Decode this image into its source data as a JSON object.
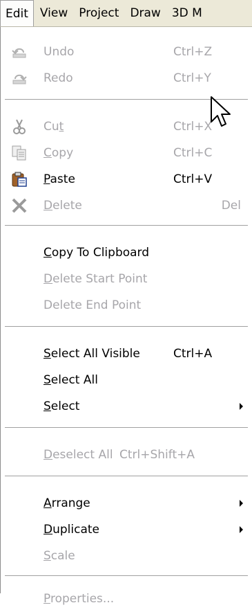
{
  "menubar": {
    "items": [
      {
        "label": "Edit"
      },
      {
        "label": "View"
      },
      {
        "label": "Project"
      },
      {
        "label": "Draw"
      },
      {
        "label": "3D M"
      }
    ]
  },
  "menu": {
    "undo": {
      "label": "Undo",
      "shortcut": "Ctrl+Z",
      "icon": "undo-icon"
    },
    "redo": {
      "label": "Redo",
      "shortcut": "Ctrl+Y",
      "icon": "redo-icon"
    },
    "cut": {
      "label_pre": "Cu",
      "label_u": "t",
      "shortcut": "Ctrl+X",
      "icon": "scissors-icon"
    },
    "copy": {
      "label_u": "C",
      "label_post": "opy",
      "shortcut": "Ctrl+C",
      "icon": "copy-icon"
    },
    "paste": {
      "label_u": "P",
      "label_post": "aste",
      "shortcut": "Ctrl+V",
      "icon": "clipboard-icon"
    },
    "delete": {
      "label_u": "D",
      "label_post": "elete",
      "shortcut": "Del",
      "icon": "delete-x-icon"
    },
    "copy_to_clipboard": {
      "label_u": "C",
      "label_post": "opy To Clipboard"
    },
    "delete_start_point": {
      "label_u": "D",
      "label_post": "elete Start Point"
    },
    "delete_end_point": {
      "label": "Delete End Point"
    },
    "select_all_visible": {
      "label_u": "S",
      "label_post": "elect All Visible",
      "shortcut": "Ctrl+A"
    },
    "select_all": {
      "label_u": "S",
      "label_post": "elect All"
    },
    "select": {
      "label_u": "S",
      "label_post": "elect"
    },
    "deselect_all": {
      "label_u": "D",
      "label_post": "eselect All",
      "shortcut": "Ctrl+Shift+A"
    },
    "arrange": {
      "label_u": "A",
      "label_post": "rrange"
    },
    "duplicate": {
      "label_u": "D",
      "label_post": "uplicate"
    },
    "scale": {
      "label_u": "S",
      "label_post": "cale"
    },
    "properties": {
      "label_u": "P",
      "label_post": "roperties..."
    }
  }
}
